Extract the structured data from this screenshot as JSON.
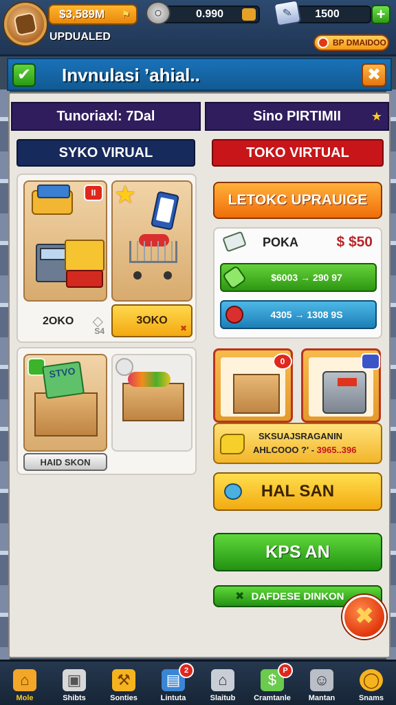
{
  "topbar": {
    "coins": "$3,589M",
    "username": "UPDUALED",
    "resource_1": "0.990",
    "resource_2": "1500",
    "promo": "BP DMAIDOO"
  },
  "title_bar": {
    "title": "Invnulasi ʼahial.."
  },
  "left_column": {
    "header": "Tunoriaxl: 7Dal",
    "banner": "SYKO VIRUAL",
    "tile_1_label": "2OKO",
    "tile_1_tag": "S4",
    "tile_2_button": "3OKO",
    "tile_3_sign": "STVO",
    "tile_3_button": "HAID SKON"
  },
  "right_column": {
    "header": "Sino PIRTIMII",
    "banner": "TOKO VIRTUAL",
    "upgrade_button": "LETOKC UPRAUIGE",
    "price_item_name": "POKA",
    "price_item_value": "$ $50",
    "green_bar": "$6003 → 290 97",
    "blue_bar": "4305 → 1308 9S",
    "product_1_badge": "0",
    "promo_line_1": "SKSUAJSRAGANIN",
    "promo_line_2_prefix": "AHLCOOO ?' - ",
    "promo_line_2_highlight": "3965..396",
    "hal_button": "HAL SAN",
    "kps_button": "KPS AN",
    "dark_button": "DAFDESE DINKON"
  },
  "bottom_nav": [
    {
      "label": "Mole",
      "icon": "home-icon",
      "glyph": "⌂"
    },
    {
      "label": "Shibts",
      "icon": "box-icon",
      "glyph": "▣"
    },
    {
      "label": "Sonties",
      "icon": "tools-icon",
      "glyph": "⚒"
    },
    {
      "label": "Lintuta",
      "icon": "register-icon",
      "glyph": "▤",
      "badge": "2"
    },
    {
      "label": "Slaitub",
      "icon": "house-icon",
      "glyph": "⌂"
    },
    {
      "label": "Cramtanle",
      "icon": "money-icon",
      "glyph": "$",
      "badge": "P"
    },
    {
      "label": "Mantan",
      "icon": "people-icon",
      "glyph": "☺"
    },
    {
      "label": "Snams",
      "icon": "ring-icon",
      "glyph": "◯"
    }
  ],
  "colors": {
    "accent_orange": "#f06d09",
    "accent_green": "#2d9612",
    "title_blue": "#115a93",
    "header_purple": "#2f1d5e",
    "banner_red": "#c7151a",
    "banner_navy": "#172a5c"
  }
}
